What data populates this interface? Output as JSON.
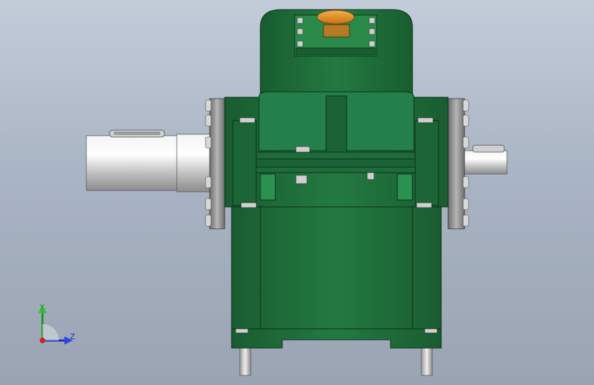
{
  "viewport": {
    "background_top": "#c3ccd9",
    "background_bottom": "#9aa4b3",
    "model_color": "#1f6a38",
    "model_dark": "#0e3f1e",
    "shaft_color": "#d8d8d8",
    "flange_color": "#8a8a8a",
    "cap_color": "#e6941e"
  },
  "triad": {
    "y_label": "Y",
    "z_label": "Z",
    "y_color": "#1f8f1f",
    "z_color": "#1b2fbf",
    "x_color": "#d02020"
  }
}
